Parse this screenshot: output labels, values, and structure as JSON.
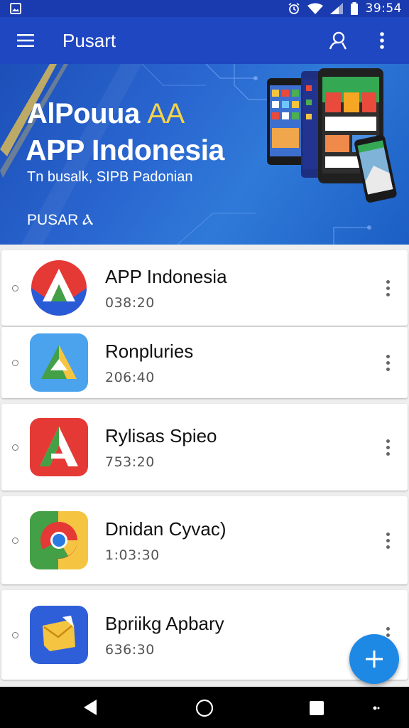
{
  "status_bar": {
    "time": "39:54",
    "icons": [
      "image-icon",
      "alarm-icon",
      "wifi-icon",
      "signal-icon",
      "battery-icon"
    ]
  },
  "app_bar": {
    "title": "Pusart",
    "icons": [
      "menu-icon",
      "profile-icon",
      "more-vert-icon"
    ]
  },
  "banner": {
    "title_line1_main": "AlPouua ",
    "title_line1_accent": "AA",
    "title_line2": "APP Indonesia",
    "subtitle": "Tn busalk, SIPB Padonian",
    "brand": "PUSAR Ⲁ"
  },
  "apps": [
    {
      "name": "APP Indonesia",
      "time": "038:20",
      "icon": "red-blue-a-icon"
    },
    {
      "name": "Ronpluries",
      "time": "206:40",
      "icon": "blue-triangle-icon"
    },
    {
      "name": "Rylisas Spieo",
      "time": "753:20",
      "icon": "red-a-icon"
    },
    {
      "name": "Dnidan Cyvac)",
      "time": "1:03:30",
      "icon": "chrome-icon"
    },
    {
      "name": "Bpriikg Apbary",
      "time": "636:30",
      "icon": "yellow-folder-icon"
    }
  ],
  "colors": {
    "app_bar": "#1f47c2",
    "status_bar": "#1a3bb0",
    "fab": "#1e88e5",
    "accent_yellow": "#f2d34a"
  },
  "fab": {
    "icon": "plus-icon"
  },
  "nav_bar": {
    "icons": [
      "back-icon",
      "home-icon",
      "recents-icon",
      "dot-icon"
    ]
  }
}
